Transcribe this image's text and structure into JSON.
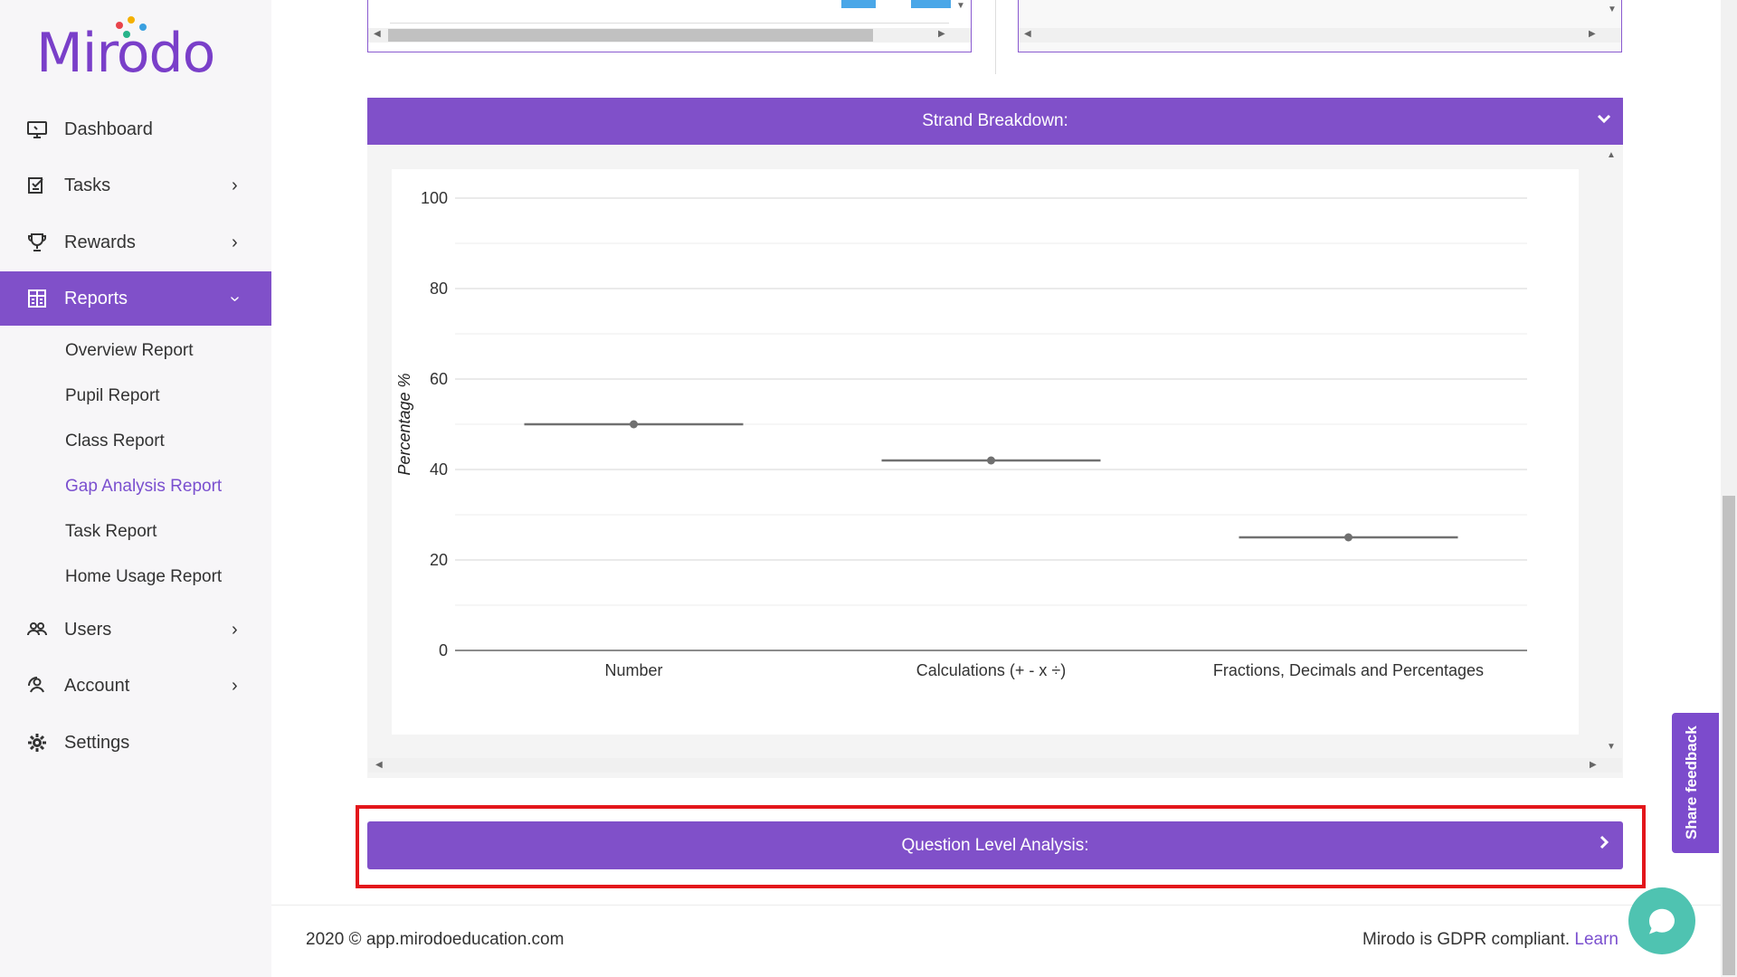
{
  "brand": {
    "name": "Mirodo",
    "accent": "#8050c9",
    "dot_colors": [
      "#e8434b",
      "#f4b000",
      "#3aa0e0",
      "#27b48a",
      "#e8434b"
    ]
  },
  "sidebar": {
    "items": [
      {
        "label": "Dashboard",
        "icon": "monitor-icon"
      },
      {
        "label": "Tasks",
        "icon": "checklist-icon"
      },
      {
        "label": "Rewards",
        "icon": "trophy-icon"
      },
      {
        "label": "Reports",
        "icon": "report-grid-icon"
      },
      {
        "label": "Users",
        "icon": "users-icon"
      },
      {
        "label": "Account",
        "icon": "account-icon"
      },
      {
        "label": "Settings",
        "icon": "gear-icon"
      }
    ],
    "reports_sub": [
      "Overview Report",
      "Pupil Report",
      "Class Report",
      "Gap Analysis Report",
      "Task Report",
      "Home Usage Report"
    ],
    "current_sub": "Gap Analysis Report"
  },
  "strand": {
    "header": "Strand Breakdown:"
  },
  "chart_data": {
    "type": "scatter",
    "categories": [
      "Number",
      "Calculations (+ - x ÷)",
      "Fractions, Decimals and Percentages"
    ],
    "values": [
      50,
      42,
      25
    ],
    "ylabel": "Percentage %",
    "xlabel": "",
    "ylim": [
      0,
      100
    ],
    "yticks": [
      0,
      20,
      40,
      60,
      80,
      100
    ],
    "grid": true,
    "series_color": "#707070"
  },
  "question_level": {
    "label": "Question Level Analysis:"
  },
  "footer": {
    "left": "2020 © app.mirodoeducation.com",
    "right": "Mirodo is GDPR compliant.",
    "link": "Learn"
  },
  "feedback": {
    "label": "Share feedback"
  }
}
